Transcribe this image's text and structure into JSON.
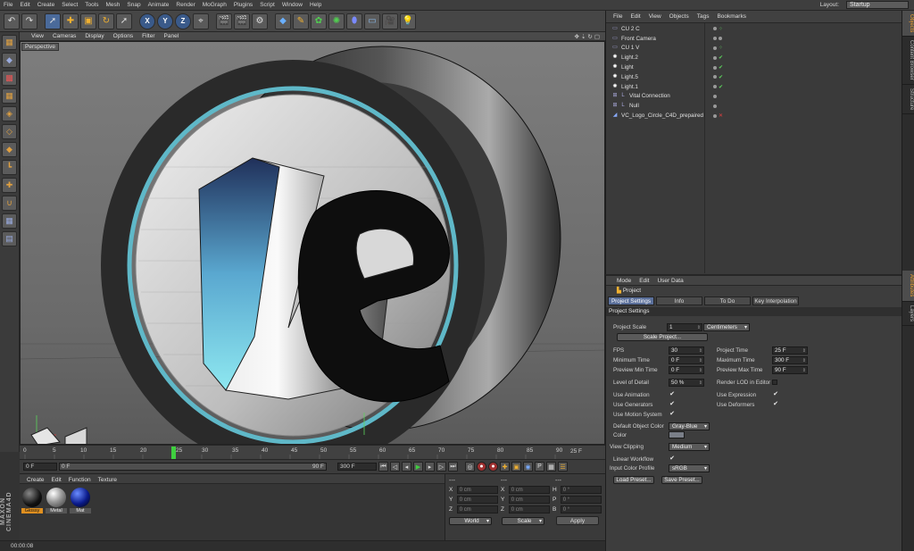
{
  "menubar": {
    "items": [
      "File",
      "Edit",
      "Create",
      "Select",
      "Tools",
      "Mesh",
      "Snap",
      "Animate",
      "Render",
      "MoGraph",
      "Plugins",
      "Script",
      "Window",
      "Help"
    ],
    "layout_label": "Layout:",
    "layout_value": "Startup"
  },
  "viewport": {
    "menu": [
      "View",
      "Cameras",
      "Display",
      "Options",
      "Filter",
      "Panel"
    ],
    "label": "Perspective"
  },
  "timeline": {
    "ticks": [
      "0",
      "5",
      "10",
      "15",
      "20",
      "25",
      "30",
      "35",
      "40",
      "45",
      "50",
      "55",
      "60",
      "65",
      "70",
      "75",
      "80",
      "85",
      "90"
    ],
    "current_frame_marker": "25",
    "end_label": "25 F"
  },
  "playback": {
    "start_field": "0 F",
    "range_start": "0 F",
    "range_end": "90 F",
    "end_field": "300 F"
  },
  "material_manager": {
    "menu": [
      "Create",
      "Edit",
      "Function",
      "Texture"
    ],
    "materials": [
      {
        "name": "Glossy",
        "selected": true
      },
      {
        "name": "Metal",
        "selected": false
      },
      {
        "name": "Mat",
        "selected": false
      }
    ]
  },
  "coordinates": {
    "header": [
      "---",
      "---",
      "---"
    ],
    "rows": [
      {
        "a_key": "X",
        "a_val": "0 cm",
        "b_key": "X",
        "b_val": "0 cm",
        "c_key": "H",
        "c_val": "0 °"
      },
      {
        "a_key": "Y",
        "a_val": "0 cm",
        "b_key": "Y",
        "b_val": "0 cm",
        "c_key": "P",
        "c_val": "0 °"
      },
      {
        "a_key": "Z",
        "a_val": "0 cm",
        "b_key": "Z",
        "b_val": "0 cm",
        "c_key": "B",
        "c_val": "0 °"
      }
    ],
    "mode1": "World",
    "mode2": "Scale",
    "apply": "Apply"
  },
  "status": {
    "time": "00:00:08"
  },
  "brand": "MAXON CINEMA4D",
  "object_manager": {
    "menu": [
      "File",
      "Edit",
      "View",
      "Objects",
      "Tags",
      "Bookmarks"
    ],
    "objects": [
      {
        "name": "CU 2 C",
        "icon": "camera-icon",
        "tag": "target"
      },
      {
        "name": "Front Camera",
        "icon": "camera-icon",
        "tag": "none"
      },
      {
        "name": "CU 1 V",
        "icon": "camera-icon",
        "tag": "target"
      },
      {
        "name": "Light.2",
        "icon": "light-icon",
        "tag": "check"
      },
      {
        "name": "Light",
        "icon": "light-icon",
        "tag": "check"
      },
      {
        "name": "Light.5",
        "icon": "light-icon",
        "tag": "check"
      },
      {
        "name": "Light.1",
        "icon": "light-icon",
        "tag": "check"
      },
      {
        "name": "Vital Connection",
        "icon": "null-icon",
        "tag": "none"
      },
      {
        "name": "Null",
        "icon": "null-icon",
        "tag": "none"
      },
      {
        "name": "VC_Logo_Circle_C4D_prepaired",
        "icon": "polygon-icon",
        "tag": "error"
      }
    ]
  },
  "side_tabs": {
    "top": [
      "Objects",
      "Content Browser",
      "Structure"
    ],
    "bottom": [
      "Attributes",
      "Layers"
    ]
  },
  "attributes": {
    "menu": [
      "Mode",
      "Edit",
      "User Data"
    ],
    "title": "Project",
    "tabs": [
      "Project Settings",
      "Info",
      "To Do",
      "Key Interpolation"
    ],
    "section": "Project Settings",
    "project_scale_label": "Project Scale",
    "project_scale_value": "1",
    "project_scale_unit": "Centimeters",
    "scale_project_btn": "Scale Project...",
    "fps_label": "FPS",
    "fps_value": "30",
    "project_time_label": "Project Time",
    "project_time_value": "25 F",
    "min_time_label": "Minimum Time",
    "min_time_value": "0 F",
    "max_time_label": "Maximum Time",
    "max_time_value": "300 F",
    "prev_min_label": "Preview Min Time",
    "prev_min_value": "0 F",
    "prev_max_label": "Preview Max Time",
    "prev_max_value": "90 F",
    "lod_label": "Level of Detail",
    "lod_value": "50 %",
    "render_lod_label": "Render LOD in Editor",
    "use_animation": "Use Animation",
    "use_expression": "Use Expression",
    "use_generators": "Use Generators",
    "use_deformers": "Use Deformers",
    "use_motion": "Use Motion System",
    "default_color_label": "Default Object Color",
    "default_color_value": "Gray-Blue",
    "color_label": "Color",
    "view_clipping_label": "View Clipping",
    "view_clipping_value": "Medium",
    "linear_workflow": "Linear Workflow",
    "input_profile_label": "Input Color Profile",
    "input_profile_value": "sRGB",
    "load_preset": "Load Preset...",
    "save_preset": "Save Preset..."
  }
}
